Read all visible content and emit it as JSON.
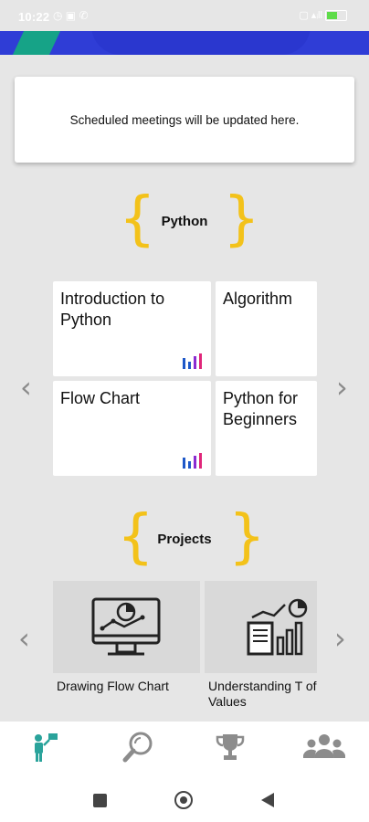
{
  "status_bar": {
    "time": "10:22"
  },
  "meeting_card": {
    "text": "Scheduled meetings will be updated here."
  },
  "courses": {
    "title": "Python",
    "items": [
      {
        "label": "Introduction to Python"
      },
      {
        "label": "Algorithm"
      },
      {
        "label": "Flow Chart"
      },
      {
        "label": "Python for Beginners"
      }
    ]
  },
  "projects": {
    "title": "Projects",
    "items": [
      {
        "label": "Drawing Flow Chart"
      },
      {
        "label": "Understanding T of Values"
      }
    ]
  },
  "colors": {
    "accent_brace": "#f3c21a",
    "active_nav": "#2aa39b",
    "banner": "#2f3dd6"
  },
  "bottom_nav": {
    "items": [
      {
        "icon": "flag-person-icon",
        "active": true
      },
      {
        "icon": "search-globe-icon",
        "active": false
      },
      {
        "icon": "trophy-icon",
        "active": false
      },
      {
        "icon": "group-icon",
        "active": false
      }
    ]
  }
}
